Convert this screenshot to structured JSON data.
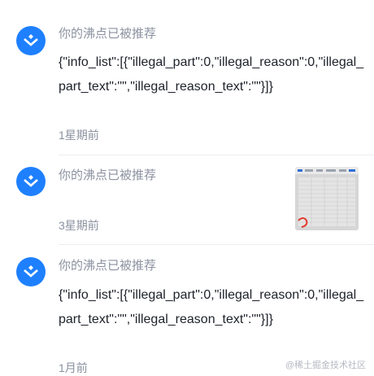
{
  "notifications": [
    {
      "title": "你的沸点已被推荐",
      "content": "{\"info_list\":[{\"illegal_part\":0,\"illegal_reason\":0,\"illegal_part_text\":\"\",\"illegal_reason_text\":\"\"}]}",
      "time": "1星期前"
    },
    {
      "title": "你的沸点已被推荐",
      "time": "3星期前",
      "has_thumbnail": true
    },
    {
      "title": "你的沸点已被推荐",
      "content": "{\"info_list\":[{\"illegal_part\":0,\"illegal_reason\":0,\"illegal_part_text\":\"\",\"illegal_reason_text\":\"\"}]}",
      "time": "1月前"
    }
  ],
  "watermark": "@稀土掘金技术社区",
  "colors": {
    "brand": "#1e80ff",
    "muted": "#8a919f",
    "text": "#1d2129"
  },
  "icons": {
    "avatar": "juejin-logo-icon"
  }
}
